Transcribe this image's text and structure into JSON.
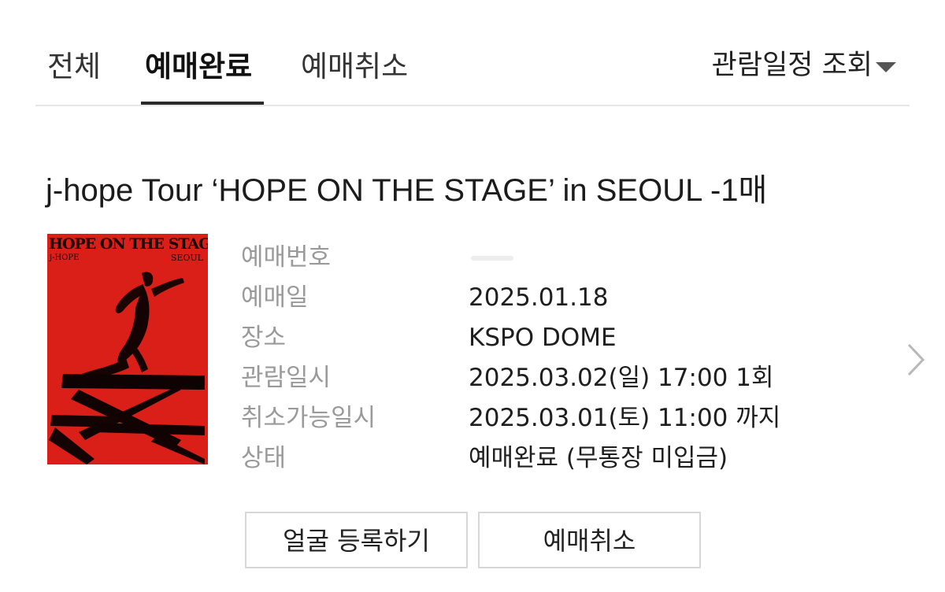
{
  "tabs": {
    "all": "전체",
    "completed": "예매완료",
    "cancelled": "예매취소",
    "active_tab": "completed"
  },
  "filter": {
    "label": "관람일정 조회",
    "icon": "caret-down-icon"
  },
  "ticket": {
    "title": "j-hope Tour ‘HOPE ON THE STAGE’ in SEOUL  -1매",
    "poster": {
      "title": "HOPE ON THE STAGE",
      "artist": "j-HOPE",
      "city": "SEOUL",
      "background_color": "#d91f18"
    },
    "details": [
      {
        "label": "예매번호",
        "value": ""
      },
      {
        "label": "예매일",
        "value": "2025.01.18"
      },
      {
        "label": "장소",
        "value": "KSPO DOME"
      },
      {
        "label": "관람일시",
        "value": "2025.03.02(일) 17:00 1회"
      },
      {
        "label": "취소가능일시",
        "value": "2025.03.01(토) 11:00 까지"
      },
      {
        "label": "상태",
        "value": "예매완료 (무통장 미입금)"
      }
    ],
    "detail_icon": "chevron-right-icon"
  },
  "buttons": {
    "face_register": "얼굴 등록하기",
    "cancel_booking": "예매취소"
  },
  "colors": {
    "active_underline": "#2a2a2a",
    "label_gray": "#9a9a9a",
    "button_border": "#d7d7d7"
  }
}
